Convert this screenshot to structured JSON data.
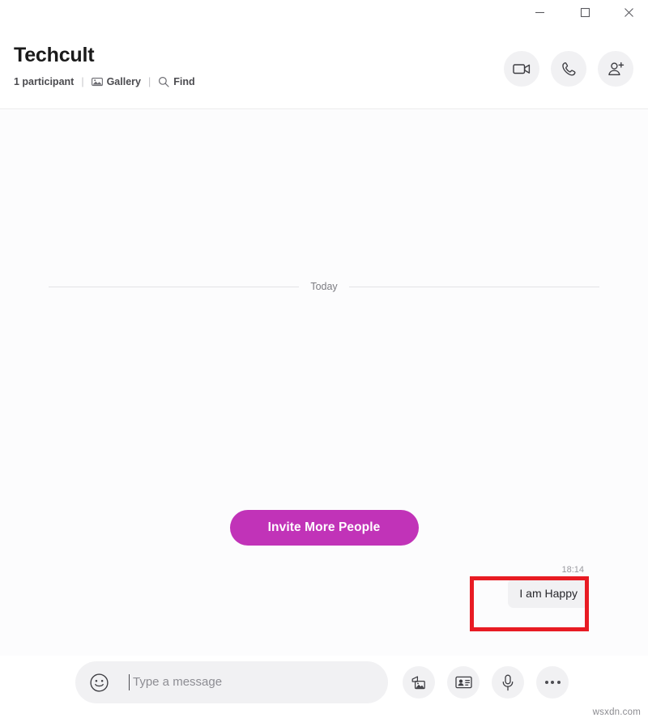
{
  "window": {
    "controls": {
      "minimize": "minimize-button",
      "maximize": "maximize-button",
      "close": "close-button"
    }
  },
  "header": {
    "title": "Techcult",
    "participants": "1 participant",
    "separator": "|",
    "gallery_label": "Gallery",
    "find_label": "Find",
    "actions": [
      {
        "name": "video-call",
        "icon": "video-camera-icon"
      },
      {
        "name": "audio-call",
        "icon": "phone-icon"
      },
      {
        "name": "add-people",
        "icon": "person-add-icon"
      }
    ]
  },
  "conversation": {
    "day_divider": "Today",
    "invite_button": "Invite More People",
    "messages": [
      {
        "time": "18:14",
        "text": "I am Happy",
        "outgoing": true,
        "highlighted": true
      }
    ]
  },
  "composer": {
    "placeholder": "Type a message",
    "value": "",
    "emoji_icon": "smiley-icon",
    "actions": [
      {
        "name": "send-media",
        "icon": "image-icon"
      },
      {
        "name": "send-contact",
        "icon": "contact-card-icon"
      },
      {
        "name": "record-audio",
        "icon": "microphone-icon"
      },
      {
        "name": "more-options",
        "icon": "ellipsis-icon"
      }
    ]
  },
  "watermark": "wsxdn.com",
  "colors": {
    "accent": "#c133b8",
    "highlight": "#e81b23",
    "bubble": "#f1f1f3",
    "surface": "#fcfcfd"
  }
}
